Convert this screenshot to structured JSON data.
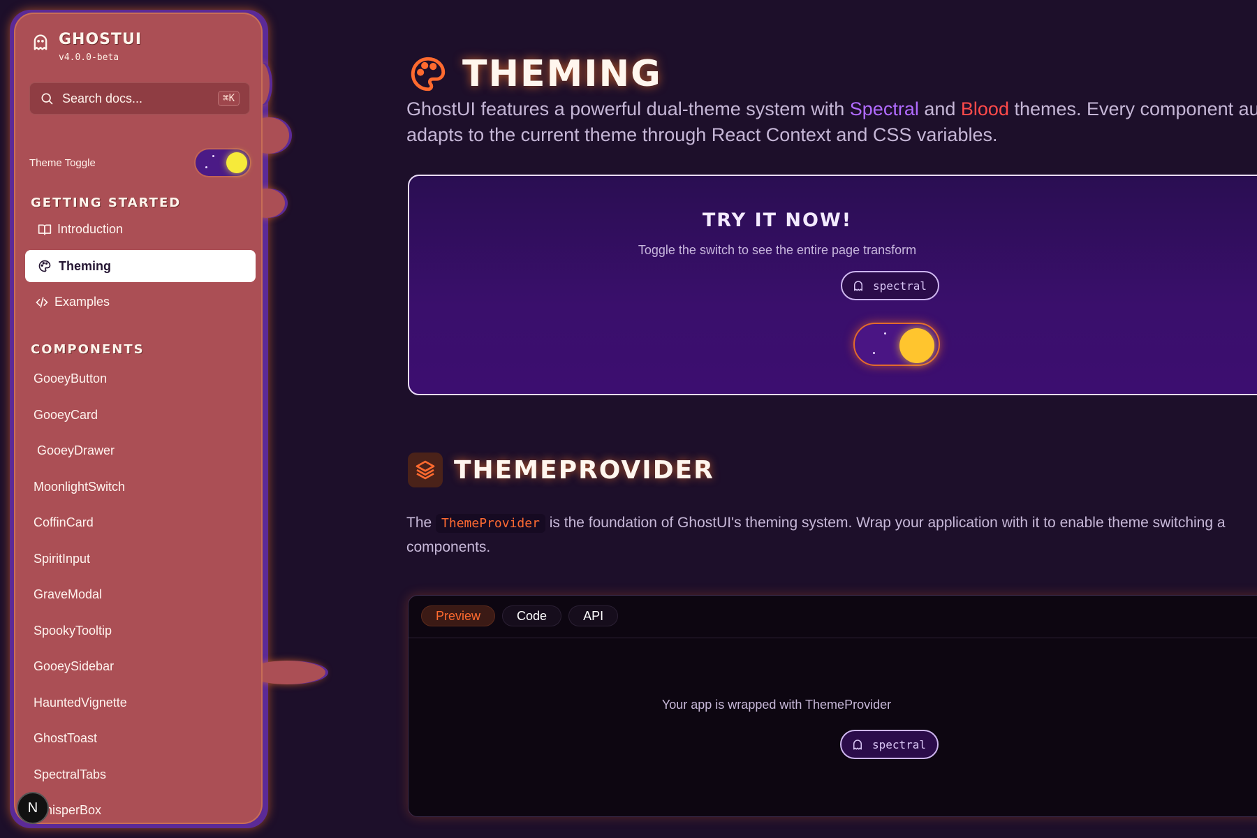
{
  "sidebar": {
    "brand_name": "GHOSTUI",
    "version": "v4.0.0-beta",
    "search": {
      "placeholder": "Search docs...",
      "shortcut": "⌘K"
    },
    "theme_toggle_label": "Theme Toggle",
    "theme_toggle_state": "on",
    "sections": {
      "getting_started": {
        "title": "GETTING STARTED",
        "items": [
          {
            "label": "Introduction",
            "icon": "book-open-icon"
          },
          {
            "label": "Theming",
            "icon": "palette-icon",
            "active": true
          },
          {
            "label": "Examples",
            "icon": "code-icon"
          }
        ]
      },
      "components": {
        "title": "COMPONENTS",
        "items": [
          "GooeyButton",
          "GooeyCard",
          "GooeyDrawer",
          "MoonlightSwitch",
          "CoffinCard",
          "SpiritInput",
          "GraveModal",
          "SpookyTooltip",
          "GooeySidebar",
          "HauntedVignette",
          "GhostToast",
          "SpectralTabs",
          "WhisperBox"
        ]
      }
    },
    "badge_letter": "N"
  },
  "main": {
    "title": "THEMING",
    "lead": {
      "part1": "GhostUI features a powerful dual-theme system with ",
      "spectral": "Spectral",
      "and": " and ",
      "blood": "Blood",
      "part2": " themes. Every component au",
      "line2": "adapts to the current theme through React Context and CSS variables."
    },
    "try_card": {
      "title": "TRY IT NOW!",
      "subtitle": "Toggle the switch to see the entire page transform",
      "theme_pill": "spectral"
    },
    "section2": {
      "title": "THEMEPROVIDER",
      "text_prefix": "The ",
      "code": "ThemeProvider",
      "text_suffix": " is the foundation of GhostUI's theming system. Wrap your application with it to enable theme switching a",
      "line2": "components."
    },
    "demo": {
      "tabs": [
        "Preview",
        "Code",
        "API"
      ],
      "active_tab": "Preview",
      "message": "Your app is wrapped with ThemeProvider",
      "theme_pill": "spectral"
    }
  },
  "colors": {
    "page_bg": "#1d0f2a",
    "sidebar_bg": "#ab4f55",
    "accent_orange": "#ff6a2f",
    "spectral_purple": "#b16bff",
    "blood_red": "#ff4a4a",
    "toggle_knob_yellow": "#f6ea3a"
  }
}
